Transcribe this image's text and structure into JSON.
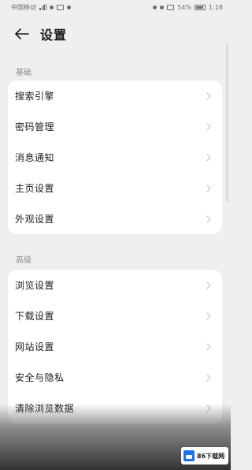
{
  "status_bar": {
    "carrier": "中国移动",
    "time": "1:18",
    "battery_text": "54%"
  },
  "header": {
    "title": "设置"
  },
  "sections": {
    "basic": {
      "label": "基础",
      "items": [
        {
          "label": "搜索引擎"
        },
        {
          "label": "密码管理"
        },
        {
          "label": "消息通知"
        },
        {
          "label": "主页设置"
        },
        {
          "label": "外观设置"
        }
      ]
    },
    "advanced": {
      "label": "高级",
      "items": [
        {
          "label": "浏览设置"
        },
        {
          "label": "下载设置"
        },
        {
          "label": "网站设置"
        },
        {
          "label": "安全与隐私"
        },
        {
          "label": "清除浏览数据"
        }
      ]
    }
  },
  "watermark": {
    "text": "86下载网"
  }
}
